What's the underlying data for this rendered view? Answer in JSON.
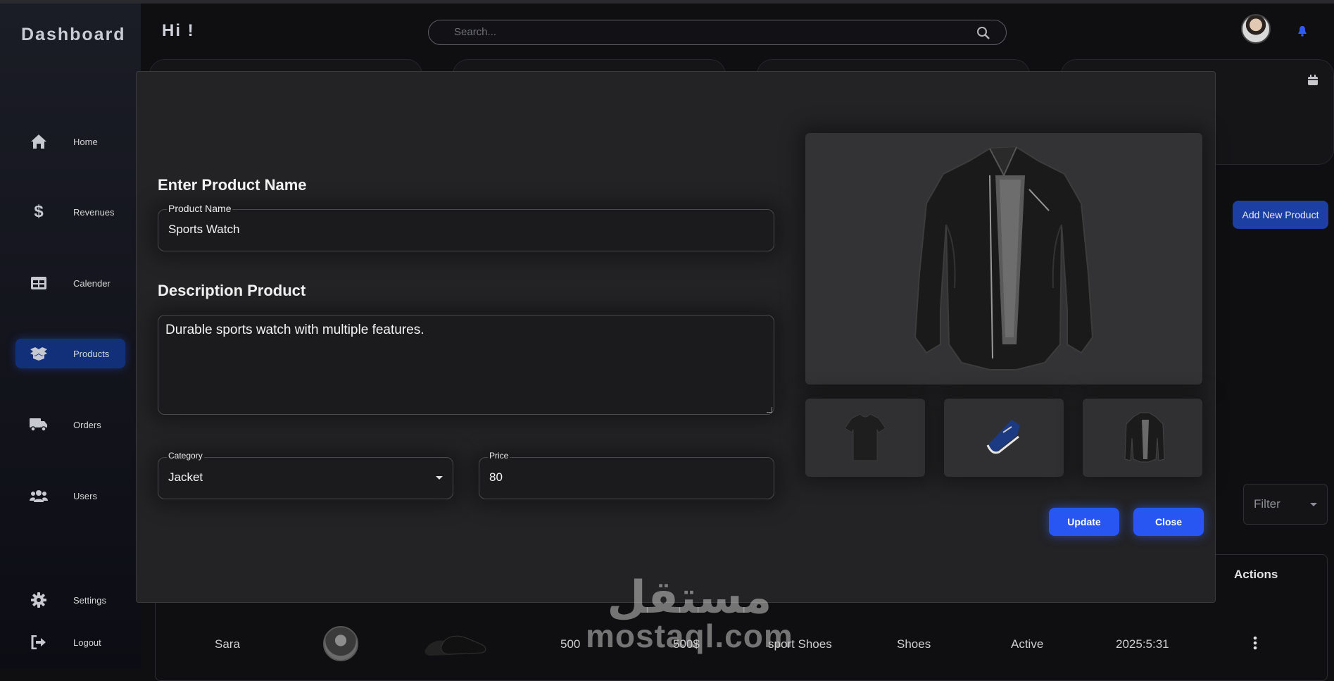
{
  "sidebar": {
    "brand": "Dashboard",
    "items": [
      {
        "label": "Home",
        "icon": "home-icon"
      },
      {
        "label": "Revenues",
        "icon": "dollar-icon"
      },
      {
        "label": "Calender",
        "icon": "table-icon"
      },
      {
        "label": "Products",
        "icon": "box-icon",
        "active": true
      },
      {
        "label": "Orders",
        "icon": "truck-icon"
      },
      {
        "label": "Users",
        "icon": "users-icon"
      },
      {
        "label": "Settings",
        "icon": "gear-icon"
      },
      {
        "label": "Logout",
        "icon": "logout-icon"
      }
    ]
  },
  "header": {
    "greeting": "Hi !",
    "search_placeholder": "Search..."
  },
  "page": {
    "add_product_label": "Add New Product",
    "filter_label": "Filter",
    "table": {
      "actions_header": "Actions",
      "row": {
        "customer": "Sara",
        "quantity": "500",
        "price": "500$",
        "product": "sport Shoes",
        "category": "Shoes",
        "status": "Active",
        "date": "2025:5:31"
      }
    },
    "watermark": {
      "arabic": "مستقل",
      "latin": "mostaql.com"
    }
  },
  "modal": {
    "name_section_title": "Enter Product Name",
    "name_field_label": "Product Name",
    "name_field_value": "Sports Watch",
    "description_title": "Description Product",
    "description_value": "Durable sports watch with multiple features.",
    "category_label": "Category",
    "category_value": "Jacket",
    "price_label": "Price",
    "price_value": "80",
    "update_label": "Update",
    "close_label": "Close"
  },
  "colors": {
    "accent": "#2756f3",
    "active_nav": "#12307a",
    "modal_bg": "#232325"
  }
}
